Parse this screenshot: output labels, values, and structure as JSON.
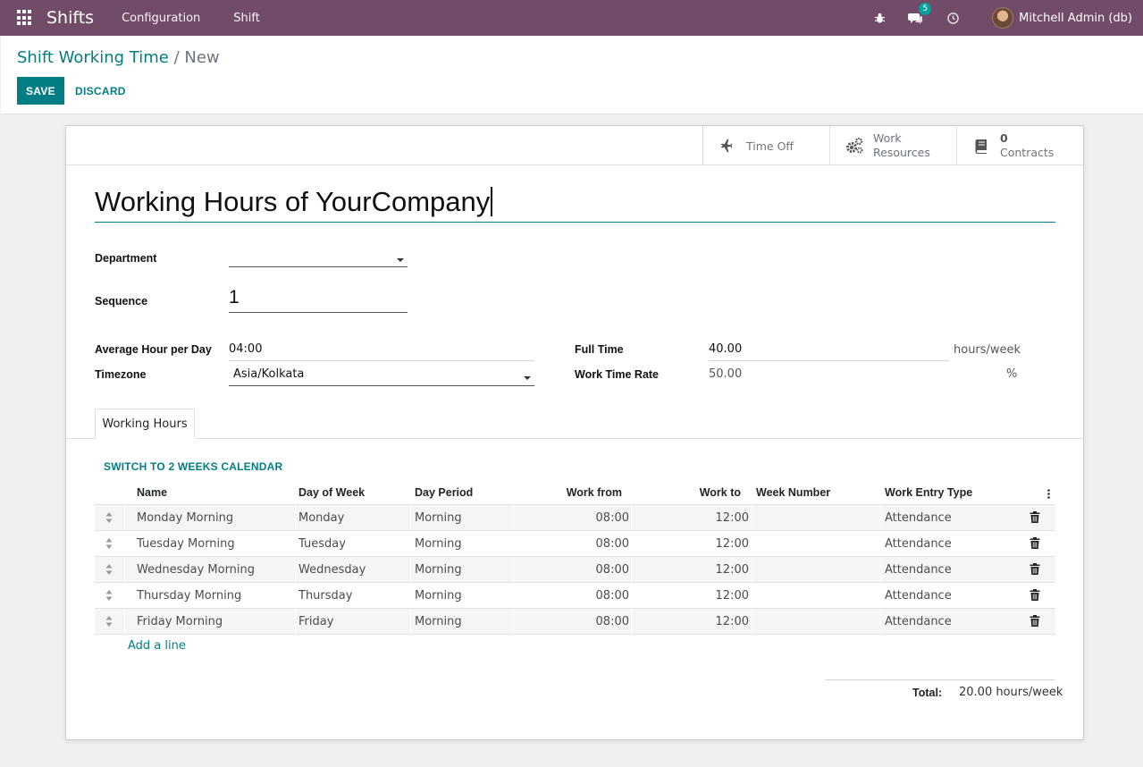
{
  "navbar": {
    "app_name": "Shifts",
    "menu": [
      "Configuration",
      "Shift"
    ],
    "messages_count": "5",
    "user_name": "Mitchell Admin (db)"
  },
  "breadcrumb": {
    "parent": "Shift Working Time",
    "separator": "/",
    "current": "New"
  },
  "actions": {
    "save": "SAVE",
    "discard": "DISCARD"
  },
  "stat_buttons": {
    "time_off": "Time Off",
    "work_resources_line1": "Work",
    "work_resources_line2": "Resources",
    "contracts_count": "0",
    "contracts_label": "Contracts"
  },
  "form": {
    "name": "Working Hours of YourCompany",
    "department_label": "Department",
    "department_value": "",
    "sequence_label": "Sequence",
    "sequence_value": "1",
    "avg_hour_label": "Average Hour per Day",
    "avg_hour_value": "04:00",
    "timezone_label": "Timezone",
    "timezone_value": "Asia/Kolkata",
    "full_time_label": "Full Time",
    "full_time_value": "40.00",
    "full_time_unit": "hours/week",
    "work_time_rate_label": "Work Time Rate",
    "work_time_rate_value": "50.00",
    "work_time_rate_unit": "%"
  },
  "tabs": {
    "working_hours": "Working Hours"
  },
  "switch_link": "SWITCH TO 2 WEEKS CALENDAR",
  "table": {
    "headers": {
      "name": "Name",
      "day_of_week": "Day of Week",
      "day_period": "Day Period",
      "work_from": "Work from",
      "work_to": "Work to",
      "week_number": "Week Number",
      "work_entry_type": "Work Entry Type"
    },
    "rows": [
      {
        "name": "Monday Morning",
        "day": "Monday",
        "period": "Morning",
        "from": "08:00",
        "to": "12:00",
        "week": "",
        "type": "Attendance"
      },
      {
        "name": "Tuesday Morning",
        "day": "Tuesday",
        "period": "Morning",
        "from": "08:00",
        "to": "12:00",
        "week": "",
        "type": "Attendance"
      },
      {
        "name": "Wednesday Morning",
        "day": "Wednesday",
        "period": "Morning",
        "from": "08:00",
        "to": "12:00",
        "week": "",
        "type": "Attendance"
      },
      {
        "name": "Thursday Morning",
        "day": "Thursday",
        "period": "Morning",
        "from": "08:00",
        "to": "12:00",
        "week": "",
        "type": "Attendance"
      },
      {
        "name": "Friday Morning",
        "day": "Friday",
        "period": "Morning",
        "from": "08:00",
        "to": "12:00",
        "week": "",
        "type": "Attendance"
      }
    ],
    "add_line": "Add a line"
  },
  "total": {
    "label": "Total:",
    "value": "20.00",
    "unit": "hours/week"
  },
  "colors": {
    "navbar": "#714b67",
    "primary": "#017e84",
    "badge": "#00a09d"
  },
  "icons": [
    "apps-grid-icon",
    "bug-icon",
    "chat-icon",
    "clock-icon",
    "plane-icon",
    "gears-icon",
    "book-icon",
    "sort-handle-icon",
    "trash-icon",
    "kebab-icon",
    "dropdown-caret-icon"
  ]
}
